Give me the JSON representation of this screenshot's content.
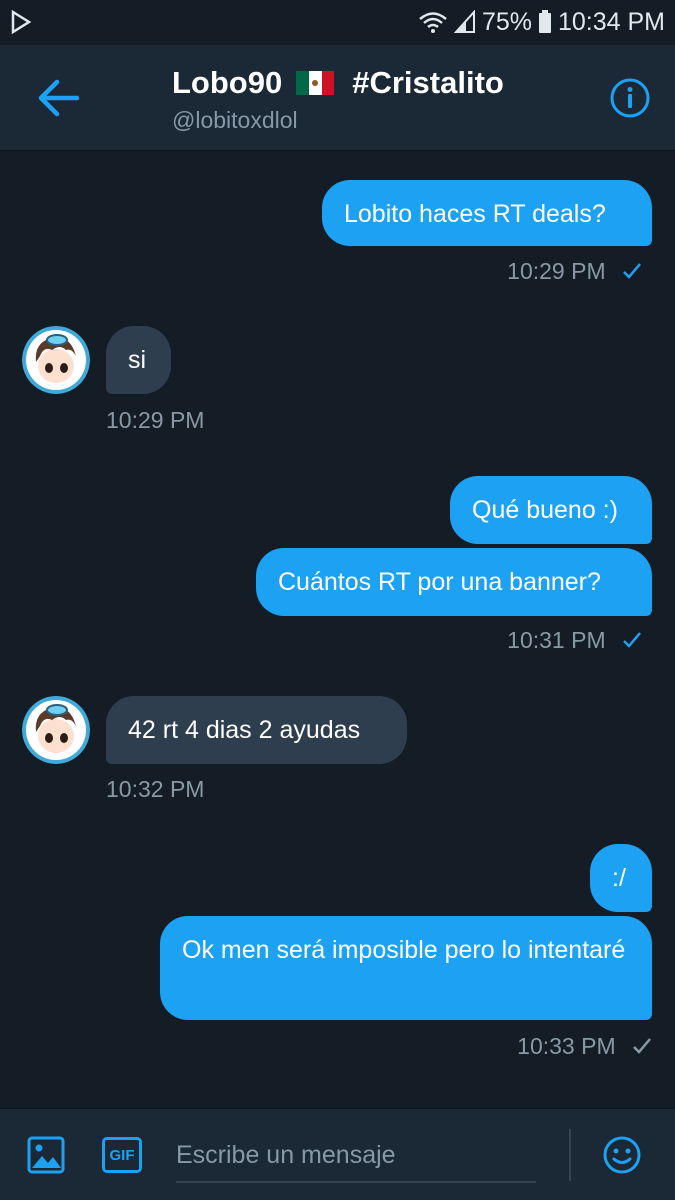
{
  "status_bar": {
    "battery": "75%",
    "time": "10:34 PM",
    "icons": [
      "play-store-icon",
      "wifi-icon",
      "signal-icon",
      "battery-icon"
    ]
  },
  "header": {
    "title_name": "Lobo90",
    "title_tag": "#Cristalito",
    "handle": "@lobitoxdlol",
    "flag": "mexico-flag-emoji"
  },
  "messages": [
    {
      "dir": "sent",
      "text": "Lobito haces RT deals?",
      "time": "10:29 PM",
      "status": "sent-check"
    },
    {
      "dir": "received",
      "text": "si",
      "time": "10:29 PM"
    },
    {
      "dir": "sent",
      "text": "Qué bueno :)"
    },
    {
      "dir": "sent",
      "text": "Cuántos RT por una banner?",
      "time": "10:31 PM",
      "status": "sent-check"
    },
    {
      "dir": "received",
      "text": "42 rt 4 dias 2 ayudas",
      "time": "10:32 PM"
    },
    {
      "dir": "sent",
      "text": ":/"
    },
    {
      "dir": "sent",
      "text": "Ok men será imposible pero lo intentaré",
      "time": "10:33 PM",
      "status": "seen-check"
    }
  ],
  "composer": {
    "placeholder": "Escribe un mensaje",
    "gif_label": "GIF"
  },
  "colors": {
    "background": "#141d26",
    "header": "#1b2836",
    "sent_bubble": "#1da1f2",
    "received_bubble": "#2f3e4e",
    "muted_text": "#8899a6",
    "accent": "#1da1f2"
  }
}
